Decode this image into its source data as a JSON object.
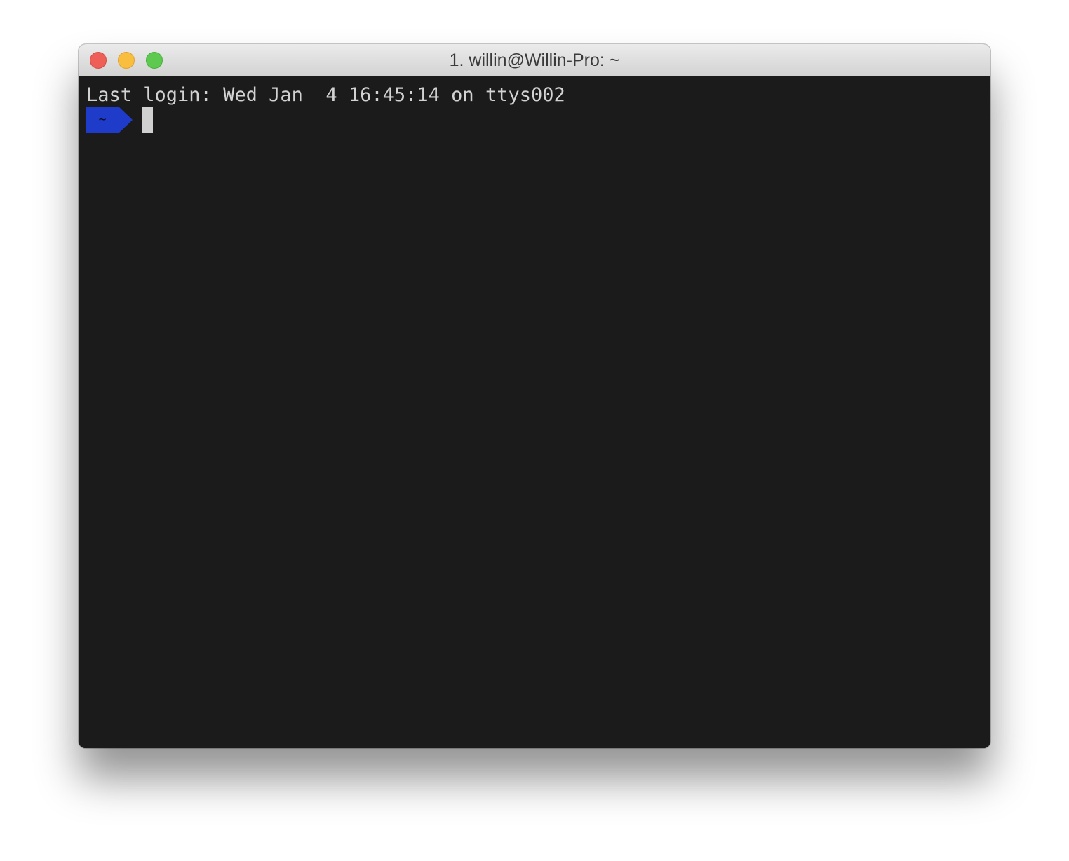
{
  "window": {
    "title": "1. willin@Willin-Pro: ~"
  },
  "terminal": {
    "last_login": "Last login: Wed Jan  4 16:45:14 on ttys002",
    "prompt_segment": "~"
  },
  "colors": {
    "terminal_background": "#1b1b1b",
    "prompt_segment": "#1f3bc9",
    "close": "#ee5f58",
    "minimize": "#f9be3e",
    "zoom": "#5ec94f"
  },
  "icons": {
    "close": "close-icon",
    "minimize": "minimize-icon",
    "zoom": "zoom-icon"
  }
}
